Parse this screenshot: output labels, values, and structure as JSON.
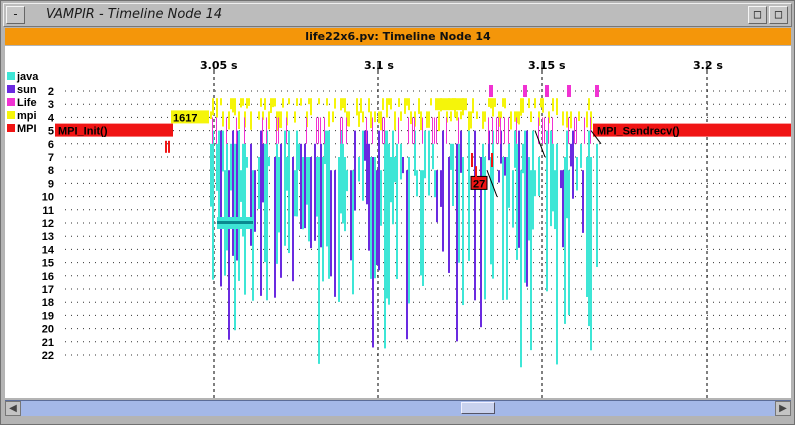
{
  "window": {
    "title": "VAMPIR - Timeline Node 14",
    "buttons": [
      "-",
      "□",
      "□"
    ]
  },
  "header": {
    "title": "life22x6.pv: Timeline Node 14"
  },
  "legend": [
    {
      "name": "java",
      "color": "#3ee6d6"
    },
    {
      "name": "sun",
      "color": "#6a2ae0"
    },
    {
      "name": "Life",
      "color": "#f032d2"
    },
    {
      "name": "mpi",
      "color": "#f5f50a"
    },
    {
      "name": "MPI",
      "color": "#f01414"
    }
  ],
  "time_ticks": [
    "3.05 s",
    "3.1 s",
    "3.15 s",
    "3.2 s"
  ],
  "rows": [
    "2",
    "3",
    "4",
    "5",
    "6",
    "7",
    "8",
    "9",
    "10",
    "11",
    "12",
    "13",
    "14",
    "15",
    "16",
    "17",
    "18",
    "19",
    "20",
    "21",
    "22"
  ],
  "labels": {
    "mpi_init": "MPI_Init()",
    "mpi_sendrecv": "MPI_Sendrecv()",
    "message_count": "1617",
    "red_box": "27"
  },
  "scrollbar": {
    "left_arrow": "◀",
    "right_arrow": "▶"
  }
}
